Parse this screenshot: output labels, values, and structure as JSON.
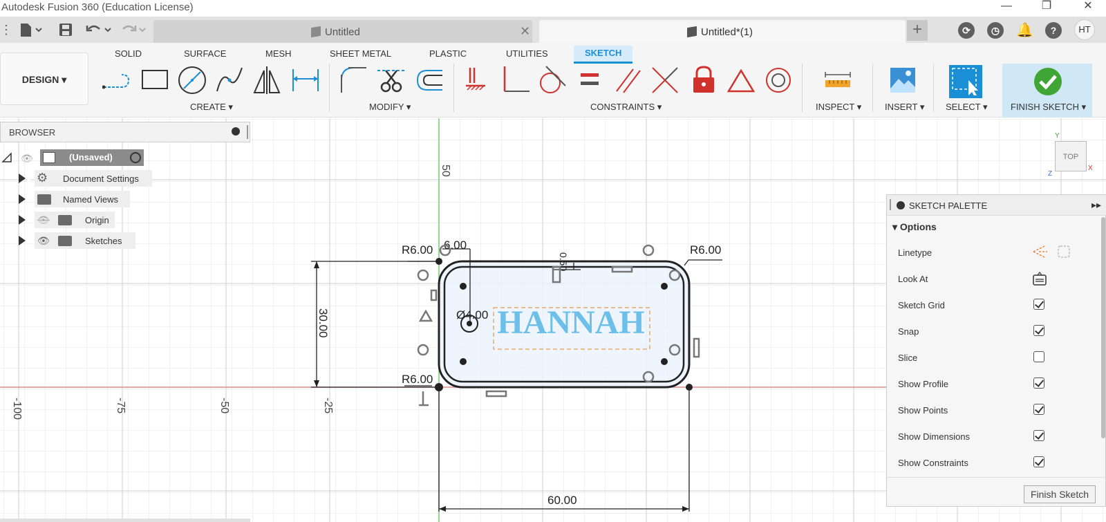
{
  "window": {
    "title": "Autodesk Fusion 360 (Education License)",
    "minimize": "—",
    "maximize": "❐",
    "close": "✕"
  },
  "tabs": [
    {
      "label": "Untitled",
      "close": "✕"
    },
    {
      "label": "Untitled*(1)",
      "close": "✕"
    }
  ],
  "top_right": {
    "plus": "+",
    "avatar": "HT",
    "help": "?"
  },
  "workspace_tabs": [
    "SOLID",
    "SURFACE",
    "MESH",
    "SHEET METAL",
    "PLASTIC",
    "UTILITIES",
    "SKETCH"
  ],
  "design_button": "DESIGN ▾",
  "toolbar_groups": {
    "create": "CREATE ▾",
    "modify": "MODIFY ▾",
    "constraints": "CONSTRAINTS ▾",
    "inspect": "INSPECT ▾",
    "insert": "INSERT ▾",
    "select": "SELECT ▾",
    "finish": "FINISH SKETCH ▾"
  },
  "browser": {
    "header": "BROWSER",
    "root": "(Unsaved)",
    "items": [
      "Document Settings",
      "Named Views",
      "Origin",
      "Sketches"
    ]
  },
  "axis_labels": {
    "x": [
      "-100",
      "-75",
      "-50",
      "-25"
    ],
    "y": [
      "50"
    ]
  },
  "sketch": {
    "text": "HANNAH",
    "dims": {
      "r_top_left": "R6.00",
      "r_top_right": "R6.00",
      "r_bottom_left": "R6.00",
      "top_offset": "6.00",
      "small_offset": "0.50",
      "diameter": "Ø4.00",
      "height": "30.00",
      "width": "60.00"
    }
  },
  "view_cube": {
    "label": "TOP",
    "x": "X",
    "y": "Y",
    "z": "Z"
  },
  "palette": {
    "title": "SKETCH PALETTE",
    "section": "Options",
    "rows": [
      {
        "label": "Linetype"
      },
      {
        "label": "Look At"
      },
      {
        "label": "Sketch Grid",
        "checked": true
      },
      {
        "label": "Snap",
        "checked": true
      },
      {
        "label": "Slice",
        "checked": false
      },
      {
        "label": "Show Profile",
        "checked": true
      },
      {
        "label": "Show Points",
        "checked": true
      },
      {
        "label": "Show Dimensions",
        "checked": true
      },
      {
        "label": "Show Constraints",
        "checked": true
      }
    ],
    "finish_button": "Finish Sketch"
  }
}
